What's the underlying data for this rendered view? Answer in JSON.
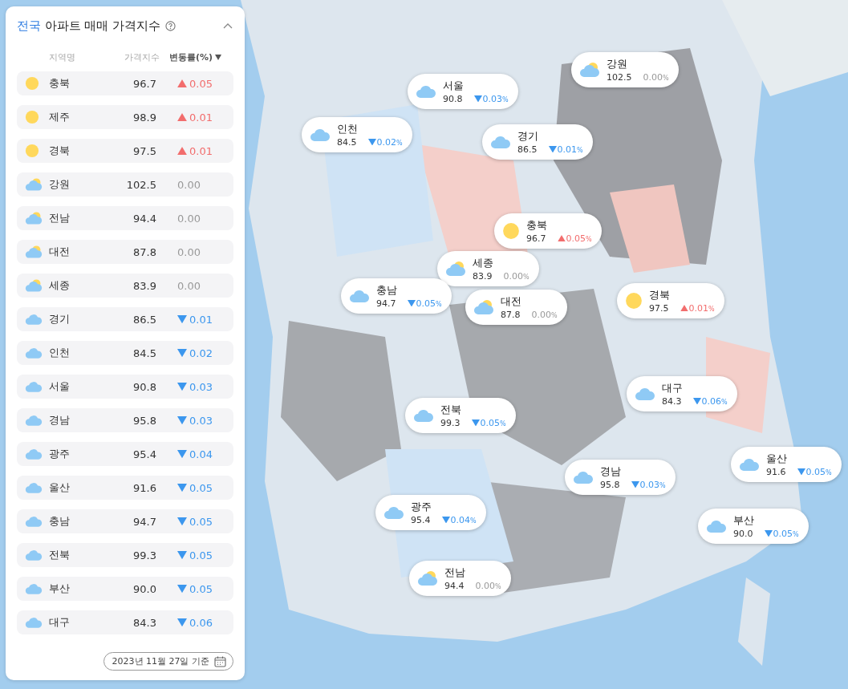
{
  "panel": {
    "title_scope": "전국",
    "title": "아파트 매매 가격지수",
    "expanded": true,
    "columns": [
      "지역명",
      "가격지수",
      "변동률(%)"
    ],
    "rows": [
      {
        "kind": "sun",
        "name": "충북",
        "index": "96.7",
        "change": "0.05",
        "rising": true,
        "falling": false
      },
      {
        "kind": "sun",
        "name": "제주",
        "index": "98.9",
        "change": "0.01",
        "rising": true,
        "falling": false
      },
      {
        "kind": "sun",
        "name": "경북",
        "index": "97.5",
        "change": "0.01",
        "rising": true,
        "falling": false
      },
      {
        "kind": "partly",
        "name": "강원",
        "index": "102.5",
        "change": "0.00",
        "rising": false,
        "falling": false
      },
      {
        "kind": "partly",
        "name": "전남",
        "index": "94.4",
        "change": "0.00",
        "rising": false,
        "falling": false
      },
      {
        "kind": "partly",
        "name": "대전",
        "index": "87.8",
        "change": "0.00",
        "rising": false,
        "falling": false
      },
      {
        "kind": "partly",
        "name": "세종",
        "index": "83.9",
        "change": "0.00",
        "rising": false,
        "falling": false
      },
      {
        "kind": "cloud",
        "name": "경기",
        "index": "86.5",
        "change": "0.01",
        "rising": false,
        "falling": true
      },
      {
        "kind": "cloud",
        "name": "인천",
        "index": "84.5",
        "change": "0.02",
        "rising": false,
        "falling": true
      },
      {
        "kind": "cloud",
        "name": "서울",
        "index": "90.8",
        "change": "0.03",
        "rising": false,
        "falling": true
      },
      {
        "kind": "cloud",
        "name": "경남",
        "index": "95.8",
        "change": "0.03",
        "rising": false,
        "falling": true
      },
      {
        "kind": "cloud",
        "name": "광주",
        "index": "95.4",
        "change": "0.04",
        "rising": false,
        "falling": true
      },
      {
        "kind": "cloud",
        "name": "울산",
        "index": "91.6",
        "change": "0.05",
        "rising": false,
        "falling": true
      },
      {
        "kind": "cloud",
        "name": "충남",
        "index": "94.7",
        "change": "0.05",
        "rising": false,
        "falling": true
      },
      {
        "kind": "cloud",
        "name": "전북",
        "index": "99.3",
        "change": "0.05",
        "rising": false,
        "falling": true
      },
      {
        "kind": "cloud",
        "name": "부산",
        "index": "90.0",
        "change": "0.05",
        "rising": false,
        "falling": true
      },
      {
        "kind": "cloud",
        "name": "대구",
        "index": "84.3",
        "change": "0.06",
        "rising": false,
        "falling": true
      }
    ],
    "date": "2023년 11월 27일 기준"
  },
  "map": {
    "kind": "picture",
    "bubbles": [
      {
        "kind": "partly",
        "name": "강원",
        "index": "102.5",
        "change": "0.00",
        "unit": "%",
        "rising": false,
        "falling": false
      },
      {
        "kind": "cloud",
        "name": "서울",
        "index": "90.8",
        "change": "0.03",
        "unit": "%",
        "rising": false,
        "falling": true
      },
      {
        "kind": "cloud",
        "name": "인천",
        "index": "84.5",
        "change": "0.02",
        "unit": "%",
        "rising": false,
        "falling": true
      },
      {
        "kind": "cloud",
        "name": "경기",
        "index": "86.5",
        "change": "0.01",
        "unit": "%",
        "rising": false,
        "falling": true
      },
      {
        "kind": "sun",
        "name": "충북",
        "index": "96.7",
        "change": "0.05",
        "unit": "%",
        "rising": true,
        "falling": false
      },
      {
        "kind": "partly",
        "name": "세종",
        "index": "83.9",
        "change": "0.00",
        "unit": "%",
        "rising": false,
        "falling": false
      },
      {
        "kind": "cloud",
        "name": "충남",
        "index": "94.7",
        "change": "0.05",
        "unit": "%",
        "rising": false,
        "falling": true
      },
      {
        "kind": "partly",
        "name": "대전",
        "index": "87.8",
        "change": "0.00",
        "unit": "%",
        "rising": false,
        "falling": false
      },
      {
        "kind": "sun",
        "name": "경북",
        "index": "97.5",
        "change": "0.01",
        "unit": "%",
        "rising": true,
        "falling": false
      },
      {
        "kind": "cloud",
        "name": "대구",
        "index": "84.3",
        "change": "0.06",
        "unit": "%",
        "rising": false,
        "falling": true
      },
      {
        "kind": "cloud",
        "name": "전북",
        "index": "99.3",
        "change": "0.05",
        "unit": "%",
        "rising": false,
        "falling": true
      },
      {
        "kind": "cloud",
        "name": "경남",
        "index": "95.8",
        "change": "0.03",
        "unit": "%",
        "rising": false,
        "falling": true
      },
      {
        "kind": "cloud",
        "name": "울산",
        "index": "91.6",
        "change": "0.05",
        "unit": "%",
        "rising": false,
        "falling": true
      },
      {
        "kind": "cloud",
        "name": "광주",
        "index": "95.4",
        "change": "0.04",
        "unit": "%",
        "rising": false,
        "falling": true
      },
      {
        "kind": "cloud",
        "name": "부산",
        "index": "90.0",
        "change": "0.05",
        "unit": "%",
        "rising": false,
        "falling": true
      },
      {
        "kind": "partly",
        "name": "전남",
        "index": "94.4",
        "change": "0.00",
        "unit": "%",
        "rising": false,
        "falling": false
      }
    ]
  }
}
